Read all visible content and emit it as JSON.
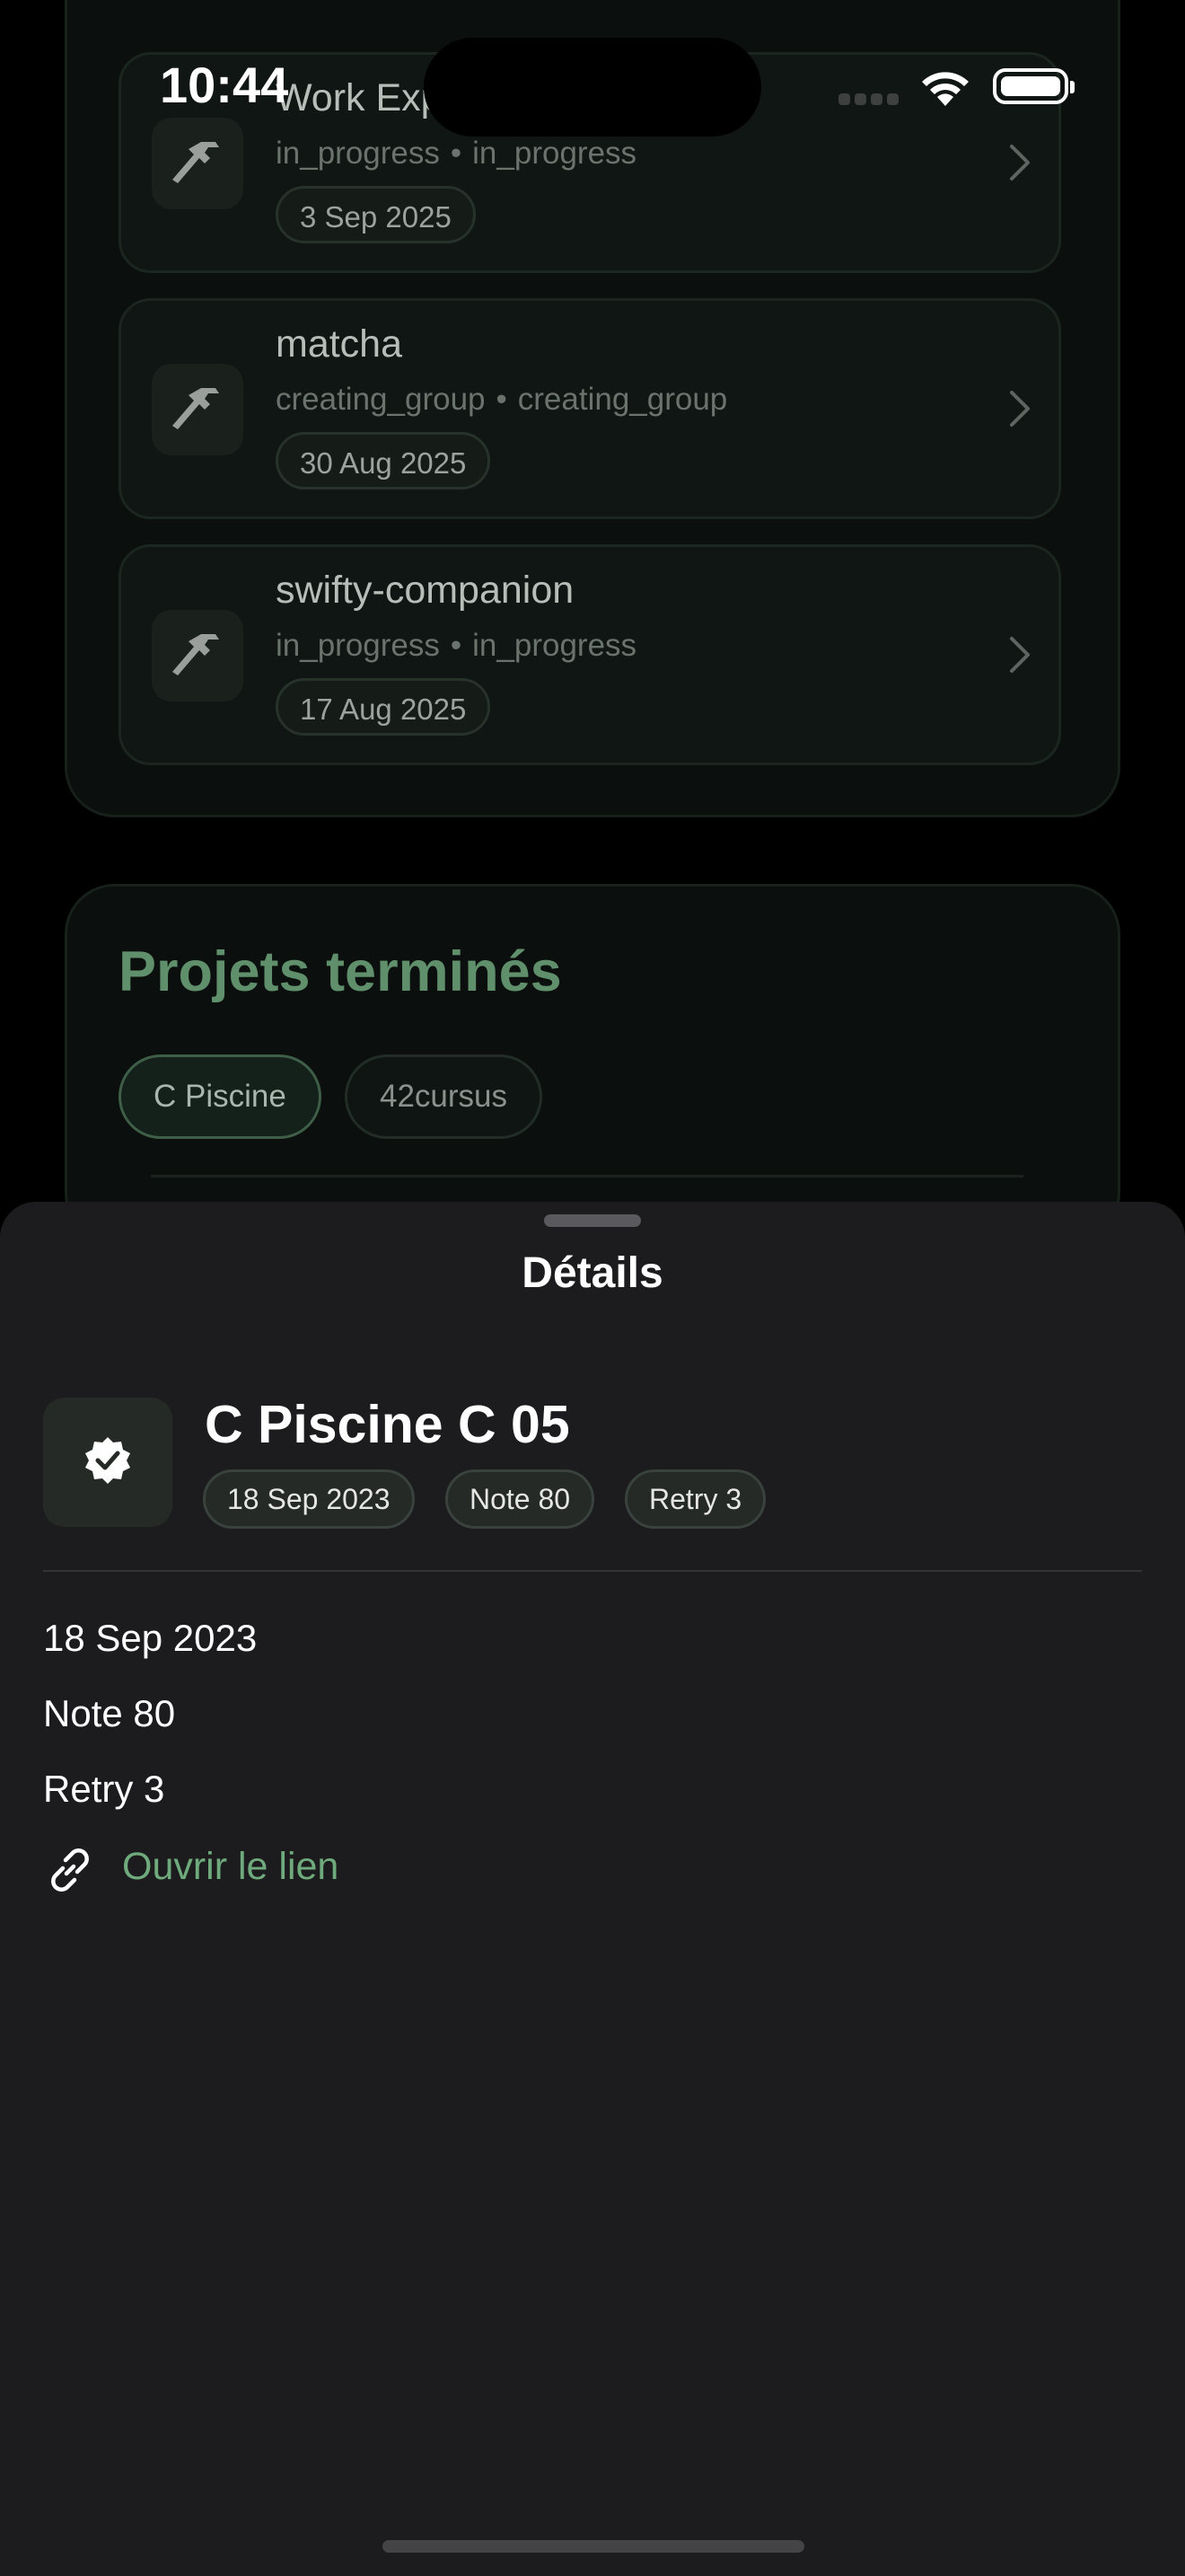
{
  "status_bar": {
    "time": "10:44"
  },
  "in_progress_projects": [
    {
      "title": "Work Exp",
      "status": "in_progress",
      "status2": "in_progress",
      "date": "3 Sep 2025",
      "icon": "hammer-icon"
    },
    {
      "title": "matcha",
      "status": "creating_group",
      "status2": "creating_group",
      "date": "30 Aug 2025",
      "icon": "hammer-icon"
    },
    {
      "title": "swifty-companion",
      "status": "in_progress",
      "status2": "in_progress",
      "date": "17 Aug 2025",
      "icon": "hammer-icon"
    }
  ],
  "finished_section": {
    "title": "Projets terminés",
    "filters": [
      {
        "label": "C Piscine",
        "selected": true
      },
      {
        "label": "42cursus",
        "selected": false
      }
    ]
  },
  "sheet": {
    "title": "Détails",
    "project_title": "C Piscine C 05",
    "icon": "verified-badge-icon",
    "tags": [
      "18 Sep 2023",
      "Note 80",
      "Retry 3"
    ],
    "lines": [
      "18 Sep 2023",
      "Note 80",
      "Retry 3"
    ],
    "link_label": "Ouvrir le lien",
    "link_icon": "link-icon"
  },
  "colors": {
    "accent_green": "#6faa7c",
    "section_title_green": "#5f8f6b",
    "sheet_bg": "#1c1c1e"
  }
}
